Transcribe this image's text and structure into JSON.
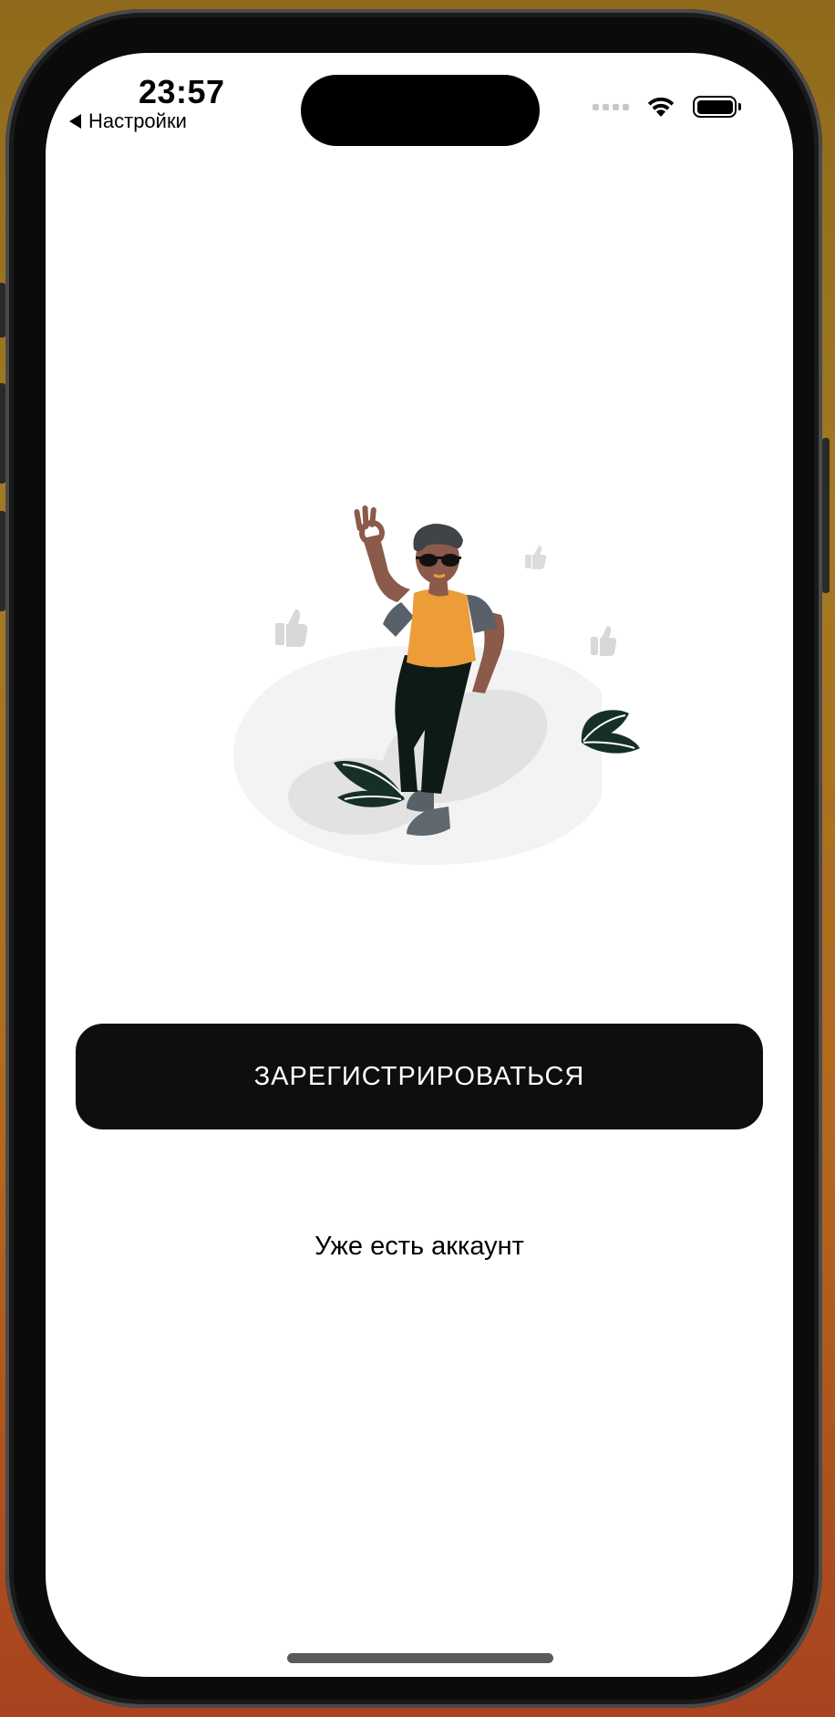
{
  "status_bar": {
    "time": "23:57",
    "back_label": "Настройки",
    "icons": [
      "cellular-signal-icon",
      "wifi-icon",
      "battery-icon"
    ]
  },
  "illustration": {
    "subject": "person-ok-gesture-illustration",
    "colors": {
      "shirt": "#ec9d38",
      "sleeves": "#58606a",
      "pants": "#0e1a16",
      "skin": "#8b5a4a",
      "hair": "#3e4448",
      "leaves": "#163027",
      "floor": "#f3f3f3",
      "shadow": "#e2e2e2",
      "thumbs": "#d8d8d8"
    }
  },
  "actions": {
    "register_label": "ЗАРЕГИСТРИРОВАТЬСЯ",
    "login_label": "Уже есть аккаунт"
  },
  "theme": {
    "primary_button_bg": "#0e0e0e",
    "primary_button_text": "#ffffff",
    "screen_bg": "#ffffff"
  }
}
